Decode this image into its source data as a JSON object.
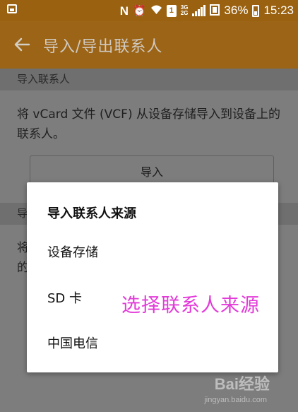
{
  "status_bar": {
    "battery_percent": "36%",
    "time": "15:23",
    "network_3g": "3G",
    "network_2g": "2G",
    "sim_badge": "1",
    "icons": [
      "image-icon",
      "nfc-icon",
      "alarm-icon",
      "wifi-icon",
      "sim-icon",
      "signal-icon",
      "data-icon",
      "battery-icon"
    ]
  },
  "app_bar": {
    "title": "导入/导出联系人",
    "back_icon": "back-arrow-icon"
  },
  "content": {
    "section_import_header": "导入联系人",
    "import_description": "将 vCard 文件 (VCF) 从设备存储导入到设备上的联系人。",
    "import_button": "导入",
    "section_export_header": "导",
    "export_description_line1_start": "将",
    "export_description_line2_start": "的"
  },
  "dialog": {
    "title": "导入联系人来源",
    "options": [
      "设备存储",
      "SD 卡",
      "中国电信"
    ]
  },
  "annotation": "选择联系人来源",
  "watermark": {
    "logo": "Bai经验",
    "url": "jingyan.baidu.com"
  },
  "colors": {
    "status_bar": "#9a6210",
    "app_bar": "#9c6416",
    "annotation": "#e23ad8",
    "dialog_bg": "#ffffff",
    "scrim_bg": "#7d7d7d"
  }
}
